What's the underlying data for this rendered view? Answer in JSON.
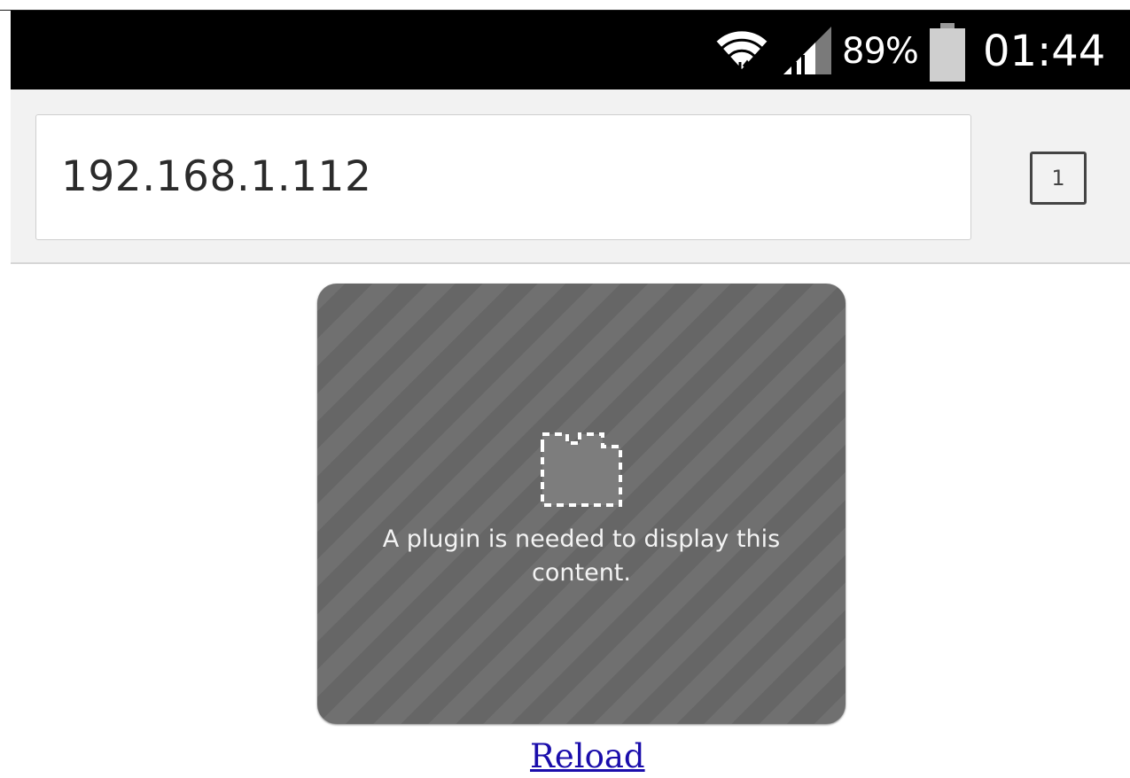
{
  "status_bar": {
    "battery_percent": "89%",
    "battery_level": 0.89,
    "time": "01:44",
    "icons": [
      "wifi-icon",
      "signal-icon",
      "battery-icon"
    ]
  },
  "browser": {
    "url": "192.168.1.112",
    "tab_count": "1"
  },
  "content": {
    "plugin_message": "A plugin is needed to display this content.",
    "plugin_icon": "puzzle-piece-icon",
    "reload_label": "Reload"
  },
  "colors": {
    "status_bar_bg": "#000000",
    "plugin_box_bg": "#6a6a6a",
    "link": "#1a0dab"
  }
}
